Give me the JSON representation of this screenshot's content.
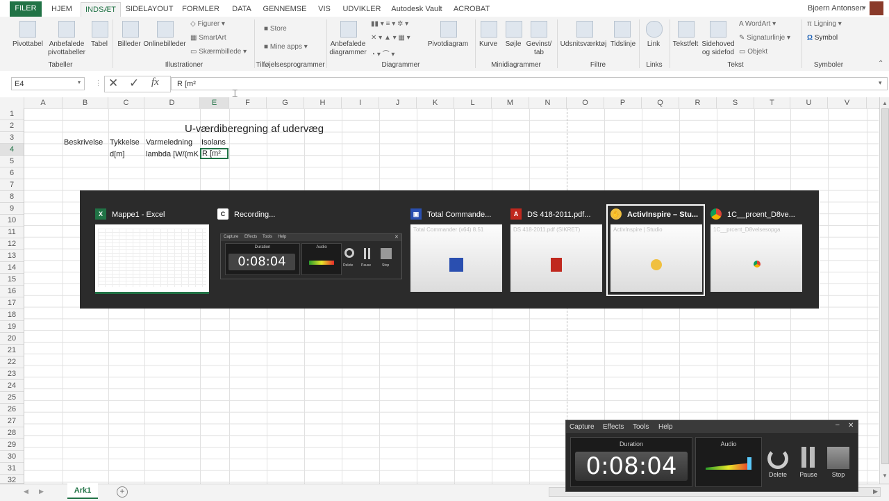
{
  "tabs": [
    "FILER",
    "HJEM",
    "INDSÆT",
    "SIDELAYOUT",
    "FORMLER",
    "DATA",
    "GENNEMSE",
    "VIS",
    "UDVIKLER",
    "Autodesk Vault",
    "ACROBAT"
  ],
  "user": "Bjoern Antonsen",
  "ribbon": {
    "pivottabel": "Pivottabel",
    "anbefalede_pivot": "Anbefalede pivottabeller",
    "tabel": "Tabel",
    "billeder": "Billeder",
    "onlinebilleder": "Onlinebilleder",
    "figurer": "Figurer",
    "smartart": "SmartArt",
    "skaermbillede": "Skærmbillede",
    "store": "Store",
    "mine_apps": "Mine apps",
    "anbefalede_diagrammer": "Anbefalede diagrammer",
    "pivotdiagram": "Pivotdiagram",
    "kurve": "Kurve",
    "soejle": "Søjle",
    "gevinst": "Gevinst/ tab",
    "udsnit": "Udsnitsværktøj",
    "tidslinje": "Tidslinje",
    "link": "Link",
    "tekstfelt": "Tekstfelt",
    "sidehoved": "Sidehoved og sidefod",
    "wordart": "WordArt",
    "signaturlinje": "Signaturlinje",
    "objekt": "Objekt",
    "ligning": "Ligning",
    "symbol": "Symbol",
    "groups": {
      "tabeller": "Tabeller",
      "illustrationer": "Illustrationer",
      "tilfoejelse": "Tilføjelsesprogrammer",
      "diagrammer": "Diagrammer",
      "minidiagrammer": "Minidiagrammer",
      "filtre": "Filtre",
      "links": "Links",
      "tekst": "Tekst",
      "symboler": "Symboler"
    }
  },
  "formula": {
    "namebox": "E4",
    "fx": "fx",
    "content": "R [m²"
  },
  "columns": [
    "A",
    "B",
    "C",
    "D",
    "E",
    "F",
    "G",
    "H",
    "I",
    "J",
    "K",
    "L",
    "M",
    "N",
    "O",
    "P",
    "Q",
    "R",
    "S",
    "T",
    "U",
    "V"
  ],
  "rows": [
    "1",
    "2",
    "3",
    "4",
    "5",
    "6",
    "7",
    "8",
    "9",
    "10",
    "11",
    "12",
    "13",
    "14",
    "15",
    "16",
    "17",
    "18",
    "19",
    "20",
    "21",
    "22",
    "23",
    "24",
    "25",
    "26",
    "27",
    "28",
    "29",
    "30",
    "31",
    "32"
  ],
  "cells": {
    "title": "U-værdiberegning af udervæg",
    "b3": "Beskrivelse",
    "c3": "Tykkelse",
    "d3": "Varmeledning",
    "e3": "Isolans",
    "c4": "d[m]",
    "d4": "lambda [W/(mK",
    "e4": "R [m²"
  },
  "sheet_tab": "Ark1",
  "switcher": {
    "items": [
      {
        "title": "Mappe1 - Excel"
      },
      {
        "title": "Recording..."
      },
      {
        "title": "Total Commande...",
        "sub": "Total Commander (x64) 8.51"
      },
      {
        "title": "DS 418-2011.pdf...",
        "sub": "DS 418-2011.pdf (SIKRET)"
      },
      {
        "title": "ActivInspire – Stu...",
        "sub": "ActivInspire | Studio"
      },
      {
        "title": "1C__prcent_D8ve...",
        "sub": "1C__prcent_D8velsesopga"
      }
    ],
    "mini_menu": [
      "Capture",
      "Effects",
      "Tools",
      "Help"
    ],
    "mini_duration_label": "Duration",
    "mini_audio_label": "Audio",
    "mini_time": "0:08:04",
    "mini_buttons": [
      "Delete",
      "Pause",
      "Stop"
    ]
  },
  "recorder": {
    "menu": [
      "Capture",
      "Effects",
      "Tools",
      "Help"
    ],
    "duration_label": "Duration",
    "audio_label": "Audio",
    "time": "0:08:04",
    "buttons": [
      "Delete",
      "Pause",
      "Stop"
    ]
  }
}
